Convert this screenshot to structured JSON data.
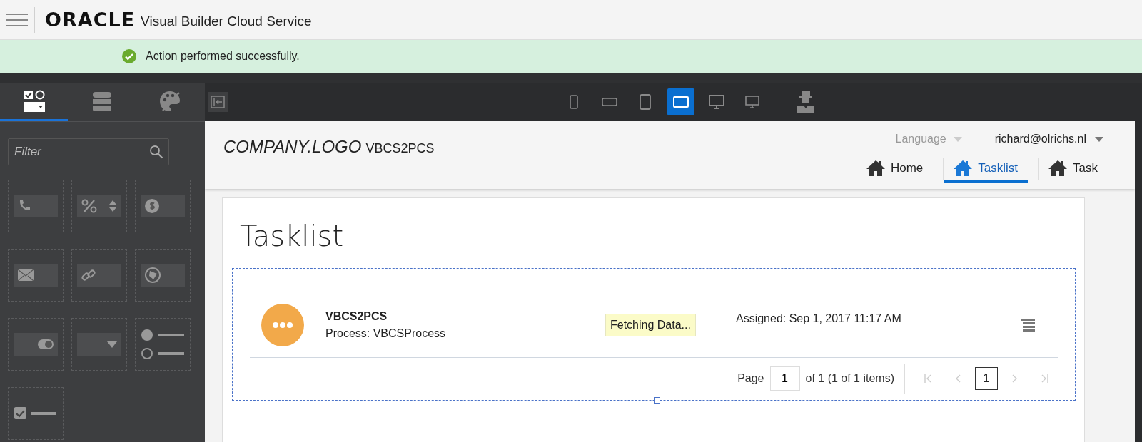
{
  "header": {
    "brand": "ORACLE",
    "product": "Visual Builder Cloud Service"
  },
  "banner": {
    "message": "Action performed successfully."
  },
  "palette_tabs": [
    {
      "kind": "components",
      "selected": true
    },
    {
      "kind": "data",
      "selected": false
    },
    {
      "kind": "themes",
      "selected": false
    }
  ],
  "filter": {
    "placeholder": "Filter"
  },
  "palette_items": [
    {
      "kind": "phone"
    },
    {
      "kind": "percent"
    },
    {
      "kind": "currency"
    },
    {
      "kind": "email"
    },
    {
      "kind": "url"
    },
    {
      "kind": "color"
    },
    {
      "kind": "toggle"
    },
    {
      "kind": "select"
    },
    {
      "kind": "radio"
    },
    {
      "kind": "checkbox"
    }
  ],
  "devices": [
    {
      "kind": "phone-portrait",
      "selected": false
    },
    {
      "kind": "phone-landscape",
      "selected": false
    },
    {
      "kind": "tablet-portrait",
      "selected": false
    },
    {
      "kind": "tablet-landscape",
      "selected": true
    },
    {
      "kind": "desktop",
      "selected": false
    },
    {
      "kind": "desktop-small",
      "selected": false
    }
  ],
  "app": {
    "logo": "COMPANY.LOGO",
    "name": "VBCS2PCS",
    "language": "Language",
    "user": "richard@olrichs.nl",
    "nav": [
      {
        "label": "Home",
        "selected": false
      },
      {
        "label": "Tasklist",
        "selected": true
      },
      {
        "label": "Task",
        "selected": false
      }
    ]
  },
  "page_title": "Tasklist",
  "tasks": [
    {
      "title": "VBCS2PCS",
      "process": "Process: VBCSProcess",
      "status": "Fetching Data...",
      "assigned": "Assigned: Sep 1, 2017 11:17 AM"
    }
  ],
  "pagination": {
    "label": "Page",
    "page_input": "1",
    "summary": "of 1 (1 of 1 items)",
    "pages": [
      {
        "label": "1",
        "selected": true
      }
    ]
  }
}
